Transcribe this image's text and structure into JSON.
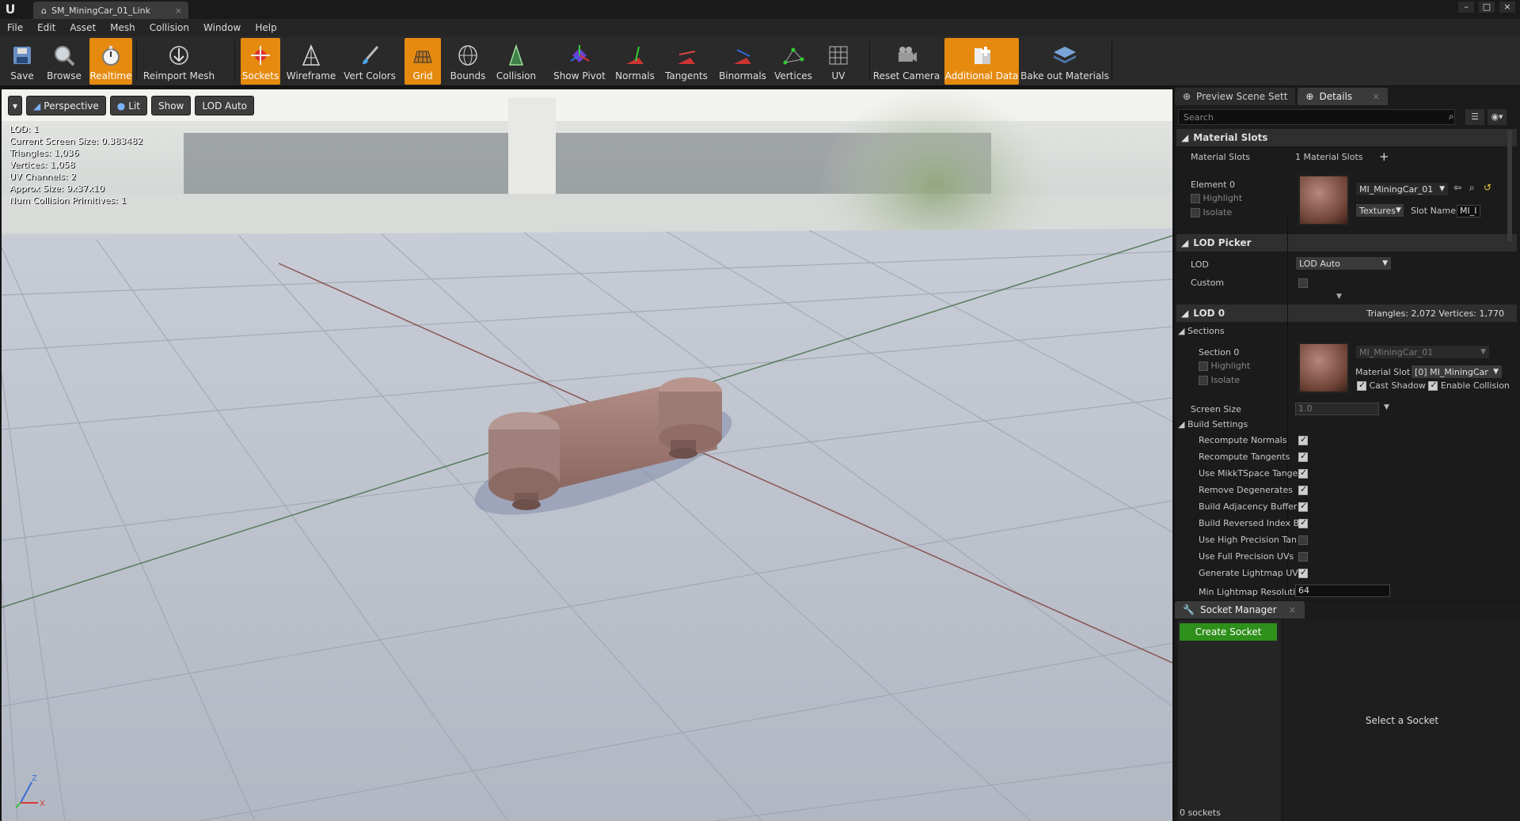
{
  "window": {
    "tab_title": "SM_MiningCar_01_Link"
  },
  "menu": [
    "File",
    "Edit",
    "Asset",
    "Mesh",
    "Collision",
    "Window",
    "Help"
  ],
  "toolbar": {
    "save": "Save",
    "browse": "Browse",
    "realtime": "Realtime",
    "reimport": "Reimport Mesh",
    "sockets": "Sockets",
    "wireframe": "Wireframe",
    "vert_colors": "Vert Colors",
    "grid": "Grid",
    "bounds": "Bounds",
    "collision": "Collision",
    "show_pivot": "Show Pivot",
    "normals": "Normals",
    "tangents": "Tangents",
    "binormals": "Binormals",
    "vertices": "Vertices",
    "uv": "UV",
    "reset_camera": "Reset Camera",
    "additional_data": "Additional Data",
    "bake_out": "Bake out Materials"
  },
  "viewport": {
    "perspective": "Perspective",
    "lit": "Lit",
    "show": "Show",
    "lod": "LOD Auto",
    "stats": [
      "LOD:  1",
      "Current Screen Size:  0.383482",
      "Triangles:  1,036",
      "Vertices:  1,058",
      "UV Channels:  2",
      "Approx Size: 9x37x10",
      "Num Collision Primitives:  1"
    ],
    "axis_z": "Z",
    "axis_x": "X"
  },
  "details": {
    "tab_preview": "Preview Scene Sett",
    "tab_details": "Details",
    "search_placeholder": "Search",
    "material_slots_header": "Material Slots",
    "material_slots_label": "Material Slots",
    "material_slots_value": "1 Material Slots",
    "element0": "Element 0",
    "highlight": "Highlight",
    "isolate": "Isolate",
    "material_name": "MI_MiningCar_01",
    "textures": "Textures",
    "slot_name_label": "Slot Name",
    "slot_name_value": "MI_I",
    "lod_picker_header": "LOD Picker",
    "lod_label": "LOD",
    "lod_value": "LOD Auto",
    "custom_label": "Custom",
    "lod0_header": "LOD 0",
    "lod0_stats": "Triangles: 2,072    Vertices: 1,770",
    "sections": "Sections",
    "section0": "Section 0",
    "section_material": "MI_MiningCar_01",
    "material_slot_label": "Material Slot",
    "material_slot_value": "[0] MI_MiningCar",
    "cast_shadow": "Cast Shadow",
    "enable_collision": "Enable Collision",
    "screen_size_label": "Screen Size",
    "screen_size_value": "1.0",
    "build_settings": "Build Settings",
    "build_rows": [
      {
        "label": "Recompute Normals",
        "checked": true
      },
      {
        "label": "Recompute Tangents",
        "checked": true
      },
      {
        "label": "Use MikkTSpace Tange",
        "checked": true
      },
      {
        "label": "Remove Degenerates",
        "checked": true
      },
      {
        "label": "Build Adjacency Buffer",
        "checked": true
      },
      {
        "label": "Build Reversed Index B",
        "checked": true
      },
      {
        "label": "Use High Precision Tan",
        "checked": false
      },
      {
        "label": "Use Full Precision UVs",
        "checked": false
      },
      {
        "label": "Generate Lightmap UVs",
        "checked": true
      }
    ],
    "min_lightmap_label": "Min Lightmap Resolutic",
    "min_lightmap_value": "64"
  },
  "sockets": {
    "tab": "Socket Manager",
    "create": "Create Socket",
    "select_hint": "Select a Socket",
    "count": "0 sockets"
  }
}
